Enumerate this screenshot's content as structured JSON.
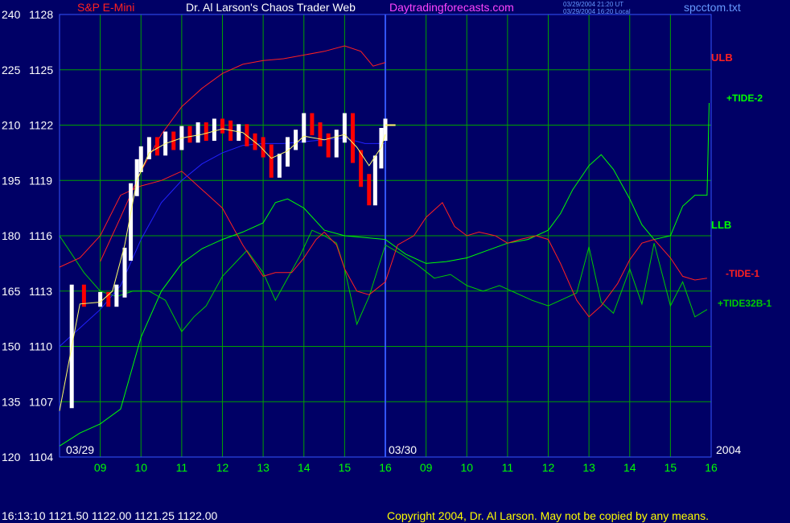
{
  "header": {
    "symbol": "S&P E-Mini",
    "title": "Dr. Al Larson's Chaos Trader Web",
    "site": "Daytradingforecasts.com",
    "timestamp_ut": "03/29/2004 21:20 UT",
    "timestamp_local": "03/29/2004 16:20 Local",
    "file": "spcctom.txt"
  },
  "footer": {
    "quote": "16:13:10  1121.50 1122.00 1121.25 1122.00",
    "copyright": "Copyright 2004, Dr. Al Larson. May not be copied by any means."
  },
  "colors": {
    "background": "#000066",
    "grid": "#00a000",
    "price_up": "#ffffff",
    "price_down": "#ff0000",
    "ma_fast": "#ffff66",
    "ma_slow": "#2222ff",
    "ulb": "#ff2020",
    "tide2": "#00ff00",
    "tide1": "#ff2020",
    "tide32b": "#00cc00",
    "llb": "#00ff00",
    "text_red": "#ff2020",
    "text_white": "#ffffff",
    "text_magenta": "#ff44ff",
    "text_blue": "#6699ff",
    "text_green": "#00ff00"
  },
  "chart_data": {
    "type": "line",
    "left_axis_labels": [
      "240",
      "225",
      "210",
      "195",
      "180",
      "165",
      "150",
      "135",
      "120"
    ],
    "right_axis_labels": [
      "1128",
      "1125",
      "1122",
      "1119",
      "1116",
      "1113",
      "1110",
      "1107",
      "1104"
    ],
    "ylim": [
      1104,
      1128
    ],
    "y2lim": [
      120,
      240
    ],
    "x_tick_labels": [
      "09",
      "10",
      "11",
      "12",
      "13",
      "14",
      "15",
      "16",
      "09",
      "10",
      "11",
      "12",
      "13",
      "14",
      "15",
      "16"
    ],
    "date_labels": [
      "03/29",
      "03/30"
    ],
    "year_label": "2004",
    "series_labels": [
      "ULB",
      "+TIDE-2",
      "LLB",
      "-TIDE-1",
      "+TIDE32B-1"
    ],
    "price": {
      "name": "S&P E-Mini",
      "hours": [
        8.0,
        8.3,
        8.6,
        9.0,
        9.2,
        9.4,
        9.6,
        9.75,
        9.9,
        10.0,
        10.2,
        10.4,
        10.6,
        10.8,
        11.0,
        11.2,
        11.4,
        11.6,
        11.8,
        12.0,
        12.2,
        12.4,
        12.6,
        12.8,
        13.0,
        13.2,
        13.4,
        13.6,
        13.8,
        14.0,
        14.2,
        14.4,
        14.6,
        14.8,
        15.0,
        15.2,
        15.4,
        15.6,
        15.75,
        15.9,
        16.0
      ],
      "values": [
        1107.0,
        1113.0,
        1112.5,
        1112.6,
        1112.5,
        1113.0,
        1115.0,
        1118.5,
        1119.8,
        1120.5,
        1121.0,
        1120.7,
        1121.3,
        1121.0,
        1121.6,
        1121.4,
        1121.8,
        1121.5,
        1122.0,
        1121.9,
        1121.5,
        1121.7,
        1121.2,
        1121.0,
        1120.6,
        1119.5,
        1120.1,
        1121.0,
        1121.4,
        1122.3,
        1121.8,
        1121.2,
        1120.6,
        1121.4,
        1122.3,
        1120.3,
        1119.0,
        1118.0,
        1120.0,
        1121.5,
        1122.0
      ],
      "last": 1122.0
    },
    "ma_fast": {
      "hours": [
        8.0,
        8.5,
        9.0,
        9.3,
        9.6,
        9.9,
        10.2,
        10.6,
        11.0,
        11.5,
        12.0,
        12.5,
        12.9,
        13.2,
        13.6,
        14.0,
        14.5,
        15.0,
        15.3,
        15.6,
        15.9,
        16.0
      ],
      "values": [
        1106.5,
        1112.3,
        1112.4,
        1113.0,
        1115.5,
        1119.0,
        1120.5,
        1121.0,
        1121.3,
        1121.5,
        1121.8,
        1121.6,
        1120.9,
        1120.2,
        1120.6,
        1121.4,
        1121.2,
        1121.5,
        1120.8,
        1119.8,
        1120.8,
        1121.5
      ]
    },
    "ma_slow": {
      "hours": [
        8.0,
        8.5,
        9.0,
        9.5,
        10.0,
        10.5,
        11.0,
        11.5,
        12.0,
        12.5,
        13.0,
        13.5,
        14.0,
        14.5,
        15.0,
        15.5,
        16.0
      ],
      "values": [
        1110.0,
        1111.0,
        1112.0,
        1113.3,
        1115.8,
        1117.8,
        1119.0,
        1119.9,
        1120.5,
        1120.9,
        1121.0,
        1121.0,
        1121.1,
        1121.2,
        1121.3,
        1121.0,
        1121.0
      ]
    },
    "ulb": {
      "name": "ULB",
      "hours": [
        9.0,
        9.5,
        10.0,
        10.5,
        11.0,
        11.5,
        12.0,
        12.5,
        13.0,
        13.5,
        14.0,
        14.5,
        15.0,
        15.4,
        15.7,
        16.0
      ],
      "values": [
        1114.6,
        1117.0,
        1119.5,
        1121.5,
        1123.0,
        1124.0,
        1124.8,
        1125.3,
        1125.5,
        1125.6,
        1125.8,
        1126.0,
        1126.3,
        1126.0,
        1125.2,
        1125.4
      ]
    },
    "tide_minus_1": {
      "name": "-TIDE-1",
      "hours": [
        8.0,
        8.5,
        9.0,
        9.5,
        10.0,
        10.5,
        11.0,
        11.5,
        12.0,
        12.5,
        13.0,
        13.3,
        13.7,
        14.0,
        14.3,
        14.5,
        14.8,
        15.0,
        15.3,
        15.6,
        16.0,
        16.3,
        16.7,
        17.0,
        17.4,
        17.7,
        18.0,
        18.3,
        18.7,
        19.0,
        19.3,
        19.7,
        20.0,
        20.3,
        20.7,
        21.0,
        21.3,
        21.7,
        22.0,
        22.3,
        22.6,
        23.0,
        23.3,
        23.6,
        23.9
      ],
      "values": [
        1114.3,
        1114.8,
        1116.0,
        1118.2,
        1118.7,
        1119.0,
        1119.5,
        1118.5,
        1117.5,
        1115.5,
        1113.8,
        1114.0,
        1114.0,
        1114.8,
        1115.8,
        1116.2,
        1115.5,
        1114.2,
        1113.0,
        1112.8,
        1113.5,
        1115.5,
        1116.0,
        1117.0,
        1117.8,
        1116.5,
        1116.0,
        1116.2,
        1116.0,
        1115.6,
        1115.8,
        1116.0,
        1115.8,
        1114.5,
        1112.5,
        1111.6,
        1112.2,
        1113.4,
        1114.7,
        1115.6,
        1115.8,
        1114.8,
        1113.8,
        1113.6,
        1113.7
      ]
    },
    "tide_plus_2": {
      "name": "+TIDE-2",
      "hours": [
        8.0,
        8.5,
        9.0,
        9.5,
        10.0,
        10.5,
        11.0,
        11.5,
        12.0,
        12.5,
        13.0,
        13.3,
        13.6,
        14.0,
        14.5,
        15.0,
        15.5,
        16.0,
        16.5,
        17.0,
        17.5,
        18.0,
        18.5,
        19.0,
        19.5,
        20.0,
        20.3,
        20.6,
        21.0,
        21.3,
        21.6,
        22.0,
        22.3,
        22.6,
        23.0,
        23.3,
        23.6,
        23.9,
        23.95
      ],
      "values": [
        1104.6,
        1105.3,
        1105.8,
        1106.6,
        1110.5,
        1113.0,
        1114.5,
        1115.3,
        1115.8,
        1116.2,
        1116.7,
        1117.8,
        1118.0,
        1117.5,
        1116.3,
        1116.0,
        1115.9,
        1115.8,
        1115.0,
        1114.5,
        1114.6,
        1114.8,
        1115.2,
        1115.6,
        1115.8,
        1116.3,
        1117.2,
        1118.5,
        1119.8,
        1120.4,
        1119.6,
        1118.0,
        1116.6,
        1115.8,
        1116.0,
        1117.6,
        1118.2,
        1118.2,
        1123.2
      ]
    },
    "tide32b": {
      "name": "+TIDE32B-1",
      "hours": [
        8.0,
        8.3,
        8.6,
        9.0,
        9.4,
        9.8,
        10.2,
        10.6,
        11.0,
        11.3,
        11.6,
        12.0,
        12.3,
        12.6,
        13.0,
        13.3,
        13.6,
        13.9,
        14.2,
        14.5,
        14.8,
        15.0,
        15.3,
        15.6,
        16.0,
        16.4,
        16.8,
        17.2,
        17.6,
        18.0,
        18.4,
        18.8,
        19.2,
        19.6,
        20.0,
        20.4,
        20.7,
        21.0,
        21.3,
        21.6,
        22.0,
        22.3,
        22.6,
        23.0,
        23.3,
        23.6,
        23.9
      ],
      "values": [
        1116.0,
        1115.0,
        1114.0,
        1113.0,
        1112.7,
        1113.0,
        1113.0,
        1112.5,
        1110.8,
        1111.6,
        1112.2,
        1113.8,
        1114.5,
        1115.2,
        1114.0,
        1112.5,
        1113.7,
        1114.9,
        1116.3,
        1116.0,
        1115.6,
        1114.2,
        1111.2,
        1112.7,
        1115.5,
        1115.0,
        1114.4,
        1113.7,
        1113.9,
        1113.3,
        1113.0,
        1113.3,
        1112.9,
        1112.5,
        1112.2,
        1112.6,
        1112.9,
        1115.4,
        1112.4,
        1111.8,
        1114.2,
        1112.3,
        1115.6,
        1112.2,
        1113.5,
        1111.6,
        1112.0
      ]
    }
  }
}
